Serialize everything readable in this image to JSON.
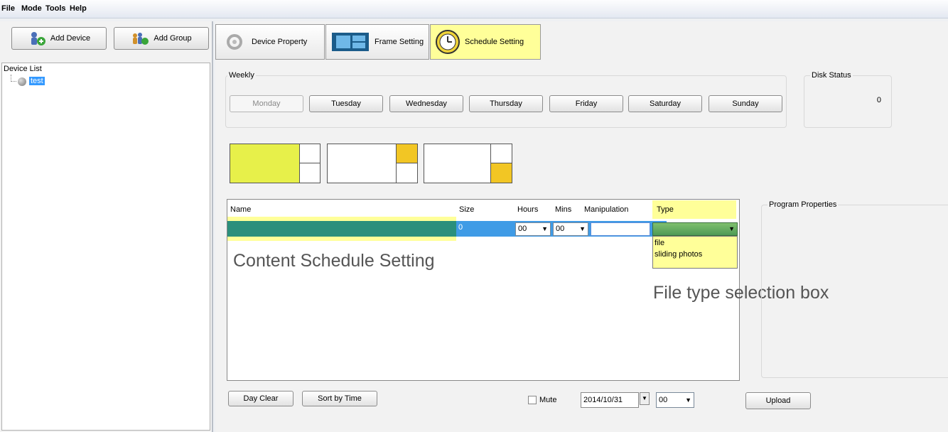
{
  "menu": [
    "File",
    "Mode",
    "Tools",
    "Help"
  ],
  "left": {
    "add_device": "Add Device",
    "add_group": "Add Group",
    "device_list_title": "Device List",
    "device_item": "test"
  },
  "tabs": [
    "Device Property",
    "Frame Setting",
    "Schedule Setting"
  ],
  "weekly": {
    "title": "Weekly",
    "days": [
      "Monday",
      "Tuesday",
      "Wednesday",
      "Thursday",
      "Friday",
      "Saturday",
      "Sunday"
    ]
  },
  "disk": {
    "title": "Disk Status",
    "value": "0"
  },
  "table": {
    "headers": [
      "Name",
      "Size",
      "Hours",
      "Mins",
      "Manipulation",
      "Type"
    ],
    "row": {
      "size": "0",
      "hours": "00",
      "mins": "00"
    },
    "type_options": [
      "file",
      "sliding photos"
    ]
  },
  "program_properties": "Program Properties",
  "annotations": {
    "content": "Content Schedule Setting",
    "filetype": "File type selection box"
  },
  "bottom": {
    "day_clear": "Day Clear",
    "sort_by_time": "Sort by Time",
    "mute": "Mute",
    "date": "2014/10/31",
    "hour": "00",
    "upload": "Upload"
  }
}
